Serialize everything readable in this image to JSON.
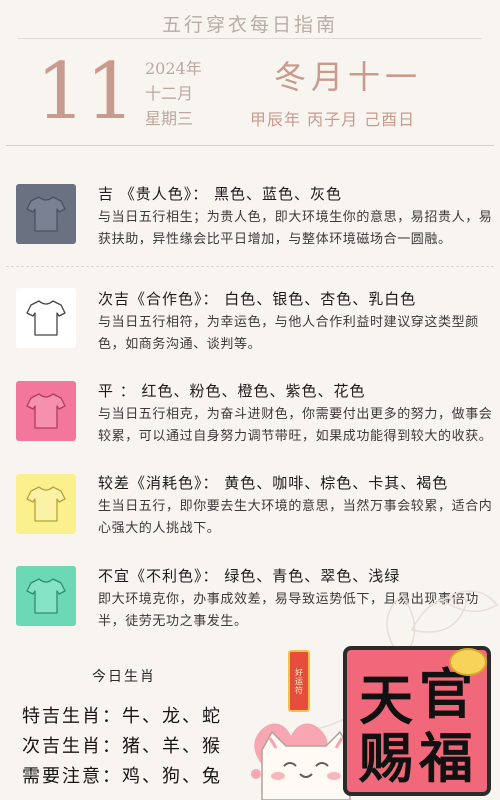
{
  "page_title": "五行穿衣每日指南",
  "date": {
    "day": "11",
    "year": "2024年",
    "month": "十二月",
    "weekday": "星期三",
    "lunar": "冬月十一",
    "ganzhi": "甲辰年 丙子月 己酉日"
  },
  "colors": [
    {
      "tile_color": "#6a7180",
      "shirt_color": "#7a8192",
      "shirt_outline": "#4b5261",
      "heading": "吉 《贵人色》： 黑色、蓝色、灰色",
      "description": "与当日五行相生；为贵人色，即大环境生你的意思，易招贵人，易获扶助，异性缘会比平日增加，与整体环境磁场合一圆融。"
    },
    {
      "tile_color": "#ffffff",
      "shirt_color": "#ffffff",
      "shirt_outline": "#444444",
      "heading": "次吉《合作色》： 白色、银色、杏色、乳白色",
      "description": "与当日五行相符，为幸运色，与他人合作利益时建议穿这类型颜色，如商务沟通、谈判等。"
    },
    {
      "tile_color": "#f2779a",
      "shirt_color": "#f590ad",
      "shirt_outline": "#b23a5f",
      "heading": "平 ： 红色、粉色、橙色、紫色、花色",
      "description": "与当日五行相克，为奋斗进财色，你需要付出更多的努力，做事会较累，可以通过自身努力调节带旺，如果成功能得到较大的收获。"
    },
    {
      "tile_color": "#fbf08e",
      "shirt_color": "#fbf2a6",
      "shirt_outline": "#b8a23a",
      "heading": "较差《消耗色》： 黄色、咖啡、棕色、卡其、褐色",
      "description": "生当日五行，即你要去生大环境的意思，当然万事会较累，适合内心强大的人挑战下。"
    },
    {
      "tile_color": "#6cd8b6",
      "shirt_color": "#86e2c4",
      "shirt_outline": "#2c8f6f",
      "heading": "不宜《不利色》： 绿色、青色、翠色、浅绿",
      "description": "即大环境克你，办事成效差，易导致运势低下，且易出现事倍功半，徒劳无功之事发生。"
    }
  ],
  "zodiac": {
    "title": "今日生肖",
    "lines": [
      "特吉生肖：牛、龙、蛇",
      "次吉生肖：猪、羊、猴",
      "需要注意：鸡、狗、兔"
    ]
  },
  "decor": {
    "charm_text": "好运符",
    "stamp_chars": [
      "天",
      "官",
      "赐",
      "福"
    ]
  }
}
